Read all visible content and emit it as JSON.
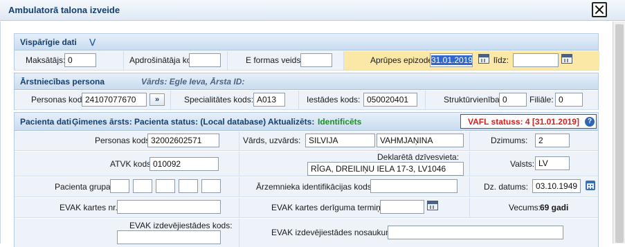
{
  "window": {
    "title": "Ambulatorā talona izveide"
  },
  "general": {
    "title": "Vispārīgie dati",
    "payer_label": "Maksātājs:",
    "payer_value": "0",
    "insurer_code_label": "Apdrošinātāja kods:",
    "insurer_code_value": "",
    "eform_type_label": "E formas veids:",
    "eform_type_value": "",
    "episode_label": "Aprūpes epizode:",
    "episode_from": "31.01.2019",
    "episode_until_label": "līdz:",
    "episode_until": ""
  },
  "practitioner": {
    "title": "Ārstniecības persona",
    "subtitle": "Vārds: Egle Ieva, Ārsta ID:",
    "person_code_label": "Personas kods:",
    "person_code_value": "24107077670",
    "lookup_button": "»",
    "specialty_label": "Specialitātes kods:",
    "specialty_value": "A013",
    "institution_label": "Iestādes kods:",
    "institution_value": "050020401",
    "structural_label": "Struktūrvienība:",
    "structural_value": "0",
    "branch_label": "Filiāle:",
    "branch_value": "0"
  },
  "patient": {
    "title_prefix": "Pacienta dati",
    "title_info": "Ģimenes ārsts: Pacienta status: (Local database) Aktualizēts:",
    "identified": "Identificēts",
    "vafl_status": "VAFL statuss:  4 [31.01.2019]",
    "help_icon": "?",
    "person_code_label": "Personas kods:",
    "person_code_value": "32002602571",
    "name_label": "Vārds, uzvārds:",
    "first_name": "SILVIJA",
    "last_name": "VAHMJAŅINA",
    "birth_no_label": "Dzimums:",
    "birth_no_value": "2",
    "atvk_label": "ATVK kods:",
    "atvk_value": "010092",
    "address_label": "Deklarētā dzīvesvieta:",
    "address_value": "RĪGA,  DREILIŅU IELA 17-3, LV1046",
    "country_label": "Valsts:",
    "country_value": "LV",
    "group_label": "Pacienta grupa:",
    "foreign_id_label": "Ārzemnieka identifikācijas kods:",
    "foreign_id_value": "",
    "birth_date_label": "Dz. datums:",
    "birth_date_value": "03.10.1949",
    "evak_card_label": "EVAK kartes nr.:",
    "evak_card_value": "",
    "evak_validity_label": "EVAK kartes derīguma termiņš:",
    "evak_validity_value": "",
    "age_label": "Vecums:",
    "age_value": "69 gadi",
    "evak_issuer_code_label": "EVAK izdevējiestādes kods:",
    "evak_issuer_code_value": "",
    "evak_issuer_name_label": "EVAK izdevējiestādes nosaukums:",
    "evak_issuer_name_value": ""
  }
}
